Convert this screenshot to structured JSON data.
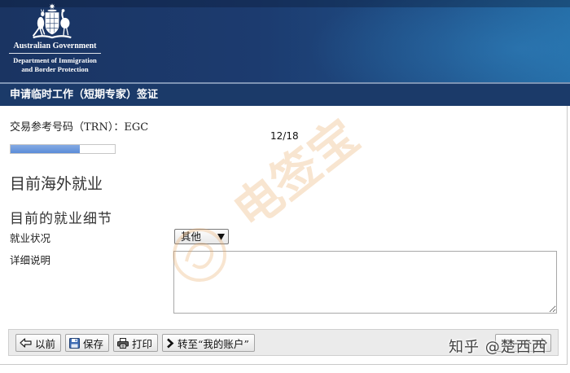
{
  "header": {
    "emblem_icon": "coat-of-arms-icon",
    "government": "Australian Government",
    "department_line1": "Department of Immigration",
    "department_line2": "and Border Protection"
  },
  "form": {
    "title": "申请临时工作（短期专家）签证",
    "trn": "交易参考号码（TRN）：EGC",
    "progress": {
      "label": "12/18",
      "current": 12,
      "total": 18
    },
    "section_title": "目前海外就业",
    "subsection_title": "目前的就业细节",
    "employment_status": {
      "label": "就业状况",
      "selected": "其他",
      "icon": "dropdown-arrow-icon"
    },
    "details": {
      "label": "详细说明"
    }
  },
  "toolbar": {
    "previous": {
      "label": "以前",
      "icon": "arrow-left-icon"
    },
    "save": {
      "label": "保存",
      "icon": "floppy-disk-icon"
    },
    "print": {
      "label": "打印",
      "icon": "printer-icon"
    },
    "my_account": {
      "label": "转至“我的账户”",
      "icon": "chevron-right-icon"
    },
    "next": {
      "label": "下一个",
      "icon": "arrow-right-icon"
    }
  },
  "watermarks": {
    "stamp": "电签宝",
    "credit": "知乎 @楚西西"
  },
  "colors": {
    "banner_dark": "#1a3462",
    "banner_light": "#236aa3",
    "title_band": "#1b3a69",
    "progress_fill": "#5b8dd9",
    "toolbar_bg": "#ebebeb",
    "stamp": "#e9a35a"
  }
}
